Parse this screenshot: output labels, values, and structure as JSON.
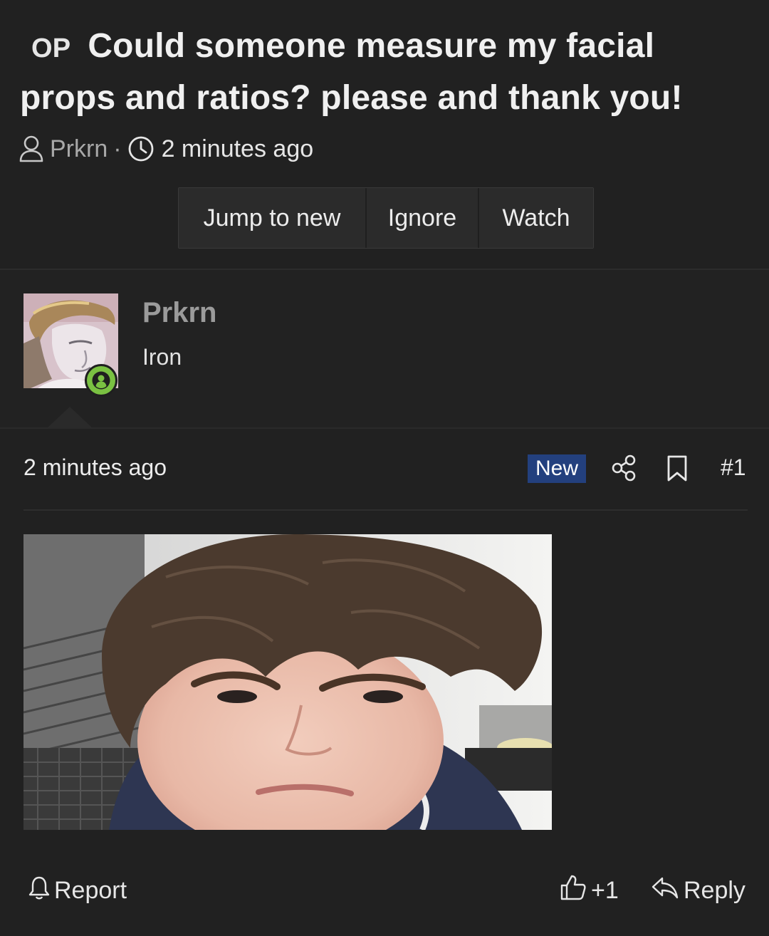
{
  "thread": {
    "prefix": "OP",
    "title": "Could someone measure my facial props and ratios? please and thank you!",
    "author": "Prkrn",
    "separator": "·",
    "time": "2 minutes ago",
    "buttons": {
      "jump_to_new": "Jump to new",
      "ignore": "Ignore",
      "watch": "Watch"
    }
  },
  "user": {
    "name": "Prkrn",
    "title": "Iron",
    "status": "online"
  },
  "post": {
    "time": "2 minutes ago",
    "badge": "New",
    "number": "#1",
    "actions": {
      "report": "Report",
      "like": "+1",
      "reply": "Reply"
    }
  },
  "colors": {
    "background": "#212121",
    "new_badge": "#23407e",
    "online_badge": "#7ac142"
  },
  "icons": [
    "user-icon",
    "clock-icon",
    "share-icon",
    "bookmark-icon",
    "bell-icon",
    "thumbs-up-icon",
    "reply-icon"
  ]
}
